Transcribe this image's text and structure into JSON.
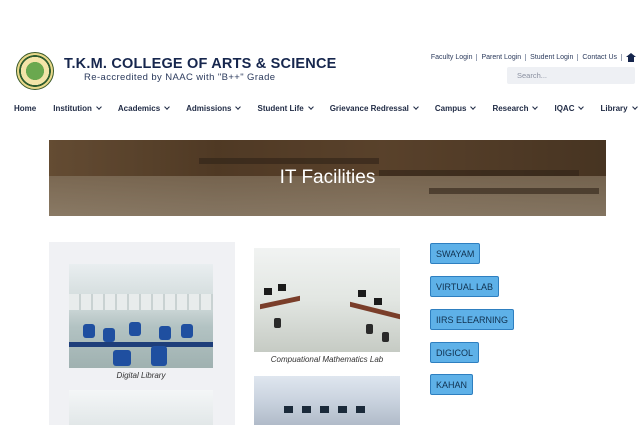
{
  "header": {
    "college_name": "T.K.M. COLLEGE OF ARTS & SCIENCE",
    "accreditation": "Re-accredited by NAAC with \"B++\" Grade",
    "top_links": [
      "Faculty Login",
      "Parent Login",
      "Student Login",
      "Contact Us"
    ],
    "search_placeholder": "Search..."
  },
  "nav": {
    "items": [
      {
        "label": "Home",
        "has_dropdown": false
      },
      {
        "label": "Institution",
        "has_dropdown": true
      },
      {
        "label": "Academics",
        "has_dropdown": true
      },
      {
        "label": "Admissions",
        "has_dropdown": true
      },
      {
        "label": "Student Life",
        "has_dropdown": true
      },
      {
        "label": "Grievance Redressal",
        "has_dropdown": true
      },
      {
        "label": "Campus",
        "has_dropdown": true
      },
      {
        "label": "Research",
        "has_dropdown": true
      },
      {
        "label": "IQAC",
        "has_dropdown": true
      },
      {
        "label": "Library",
        "has_dropdown": true
      }
    ]
  },
  "banner": {
    "title": "IT Facilities"
  },
  "gallery": {
    "captions": [
      "Digital Library",
      "Compuational Mathematics Lab"
    ]
  },
  "external_links": [
    "SWAYAM",
    "VIRTUAL LAB",
    "IIRS ELEARNING",
    "DIGICOL",
    "KAHAN"
  ],
  "colors": {
    "navy": "#16264d",
    "button_fill": "#5eb1e8",
    "button_border": "#2e7fc0",
    "search_bg": "#eef0f4",
    "gallery_bg": "#f0f1f4"
  },
  "icons": {
    "home": "home-icon",
    "dropdown": "chevron-down-icon",
    "logo": "college-emblem"
  }
}
